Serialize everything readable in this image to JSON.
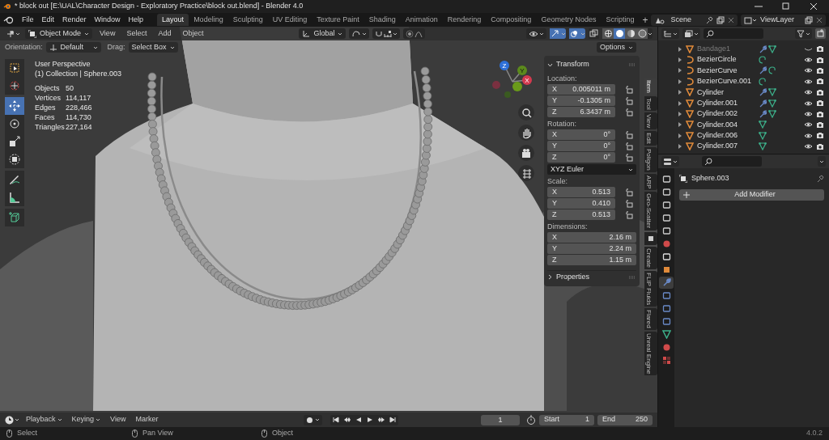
{
  "window": {
    "title": "* block out [E:\\UAL\\Character Design - Exploratory Practice\\block out.blend] - Blender 4.0"
  },
  "menu": [
    "File",
    "Edit",
    "Render",
    "Window",
    "Help"
  ],
  "workspaces": [
    {
      "label": "Layout",
      "selected": true
    },
    {
      "label": "Modeling",
      "selected": false
    },
    {
      "label": "Sculpting",
      "selected": false
    },
    {
      "label": "UV Editing",
      "selected": false
    },
    {
      "label": "Texture Paint",
      "selected": false
    },
    {
      "label": "Shading",
      "selected": false
    },
    {
      "label": "Animation",
      "selected": false
    },
    {
      "label": "Rendering",
      "selected": false
    },
    {
      "label": "Compositing",
      "selected": false
    },
    {
      "label": "Geometry Nodes",
      "selected": false
    },
    {
      "label": "Scripting",
      "selected": false
    }
  ],
  "add_workspace": "+",
  "scene": "Scene",
  "view_layer": "ViewLayer",
  "viewport": {
    "mode": "Object Mode",
    "menus": [
      "View",
      "Select",
      "Add",
      "Object"
    ],
    "transform_orientation": "Global",
    "tool_settings": {
      "orientation_label": "Orientation:",
      "orientation": "Default",
      "drag_label": "Drag:",
      "drag": "Select Box"
    },
    "options": "Options",
    "gizmos_on": true,
    "overlays_on": true,
    "shading": [
      {
        "kind": "wireframe",
        "selected": false
      },
      {
        "kind": "solid",
        "selected": true
      },
      {
        "kind": "material",
        "selected": false
      },
      {
        "kind": "rendered",
        "selected": false
      }
    ],
    "tools": [
      {
        "kind": "select",
        "selected": false
      },
      {
        "kind": "cursor",
        "selected": false
      },
      {
        "kind": "move",
        "selected": true
      },
      {
        "kind": "rotate",
        "selected": false
      },
      {
        "kind": "scale",
        "selected": false
      },
      {
        "kind": "transform",
        "selected": false
      },
      {
        "kind": "annotate",
        "selected": false
      },
      {
        "kind": "measure",
        "selected": false
      },
      {
        "kind": "add-cube",
        "selected": false
      }
    ],
    "view_name": "User Perspective",
    "collection": "(1) Collection | Sphere.003",
    "stats": [
      {
        "label": "Objects",
        "value": "50"
      },
      {
        "label": "Vertices",
        "value": "114,117"
      },
      {
        "label": "Edges",
        "value": "228,466"
      },
      {
        "label": "Faces",
        "value": "114,730"
      },
      {
        "label": "Triangles",
        "value": "227,164"
      }
    ],
    "gizmo_axes": [
      "Z",
      "Y",
      "X"
    ]
  },
  "n_panel": {
    "title": "Transform",
    "expanded": true,
    "groups": [
      {
        "label": "Location:",
        "rows": [
          {
            "axis": "X",
            "value": "0.005011 m"
          },
          {
            "axis": "Y",
            "value": "-0.1305 m"
          },
          {
            "axis": "Z",
            "value": "6.3437 m"
          }
        ]
      },
      {
        "label": "Rotation:",
        "rows": [
          {
            "axis": "X",
            "value": "0°"
          },
          {
            "axis": "Y",
            "value": "0°"
          },
          {
            "axis": "Z",
            "value": "0°"
          }
        ],
        "mode": "XYZ Euler"
      },
      {
        "label": "Scale:",
        "rows": [
          {
            "axis": "X",
            "value": "0.513"
          },
          {
            "axis": "Y",
            "value": "0.410"
          },
          {
            "axis": "Z",
            "value": "0.513"
          }
        ]
      },
      {
        "label": "Dimensions:",
        "rows": [
          {
            "axis": "X",
            "value": "2.16 m"
          },
          {
            "axis": "Y",
            "value": "2.24 m"
          },
          {
            "axis": "Z",
            "value": "1.15 m"
          }
        ]
      }
    ],
    "properties": {
      "title": "Properties",
      "expanded": false
    }
  },
  "side_tabs": [
    {
      "kind": "text",
      "label": "Item",
      "selected": true
    },
    {
      "kind": "text",
      "label": "Tool",
      "selected": false
    },
    {
      "kind": "text",
      "label": "View",
      "selected": false
    },
    {
      "kind": "text",
      "label": "Edit",
      "selected": false
    },
    {
      "kind": "text",
      "label": "Poligon",
      "selected": false
    },
    {
      "kind": "text",
      "label": "ARP",
      "selected": false
    },
    {
      "kind": "text",
      "label": "Geo-Scatter",
      "selected": false
    },
    {
      "kind": "icon",
      "selected": false
    },
    {
      "kind": "text",
      "label": "Create",
      "selected": false
    },
    {
      "kind": "text",
      "label": "FLIP Fluids",
      "selected": false
    },
    {
      "kind": "text",
      "label": "Flared",
      "selected": false
    },
    {
      "kind": "text",
      "label": "Unreal Engine",
      "selected": false
    }
  ],
  "outliner": {
    "rows": [
      {
        "name": "Bandage1",
        "kind": "mesh",
        "modifiers": true,
        "visible": false
      },
      {
        "name": "BezierCircle",
        "kind": "curve",
        "modifiers": false,
        "visible": true
      },
      {
        "name": "BezierCurve",
        "kind": "curve",
        "modifiers": true,
        "visible": true
      },
      {
        "name": "BezierCurve.001",
        "kind": "curve",
        "modifiers": false,
        "visible": true
      },
      {
        "name": "Cylinder",
        "kind": "mesh",
        "modifiers": true,
        "visible": true
      },
      {
        "name": "Cylinder.001",
        "kind": "mesh",
        "modifiers": true,
        "visible": true
      },
      {
        "name": "Cylinder.002",
        "kind": "mesh",
        "modifiers": true,
        "visible": true
      },
      {
        "name": "Cylinder.004",
        "kind": "mesh",
        "modifiers": false,
        "visible": true
      },
      {
        "name": "Cylinder.006",
        "kind": "mesh",
        "modifiers": false,
        "visible": true
      },
      {
        "name": "Cylinder.007",
        "kind": "mesh",
        "modifiers": false,
        "visible": true
      }
    ]
  },
  "properties": {
    "object": "Sphere.003",
    "add_modifier": "Add Modifier",
    "tabs": [
      {
        "kind": "tool",
        "selected": false
      },
      {
        "kind": "render",
        "selected": false
      },
      {
        "kind": "output",
        "selected": false
      },
      {
        "kind": "view-layer",
        "selected": false
      },
      {
        "kind": "scene",
        "selected": false
      },
      {
        "kind": "world",
        "selected": false
      },
      {
        "kind": "collection",
        "selected": false
      },
      {
        "kind": "object",
        "selected": false
      },
      {
        "kind": "modifier",
        "selected": true
      },
      {
        "kind": "particles",
        "selected": false
      },
      {
        "kind": "physics",
        "selected": false
      },
      {
        "kind": "constraints",
        "selected": false
      },
      {
        "kind": "data",
        "selected": false
      },
      {
        "kind": "material",
        "selected": false
      },
      {
        "kind": "texture",
        "selected": false
      }
    ]
  },
  "timeline": {
    "menus": [
      "Playback",
      "Keying",
      "View",
      "Marker"
    ],
    "frame": "1",
    "start_label": "Start",
    "start": "1",
    "end_label": "End",
    "end": "250"
  },
  "status_bar": {
    "items": [
      "Select",
      "Pan View",
      "Object"
    ],
    "version": "4.0.2"
  }
}
